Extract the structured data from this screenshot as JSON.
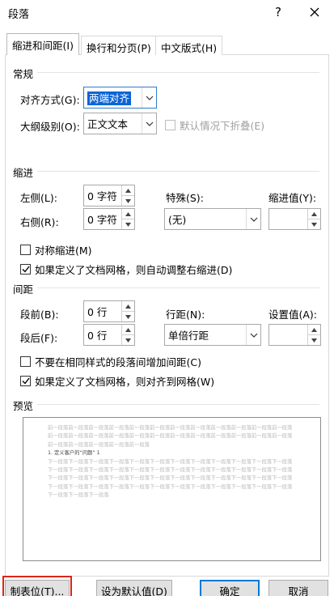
{
  "window": {
    "title": "段落",
    "help": "?",
    "close": "✕"
  },
  "tabs": [
    "缩进和间距(I)",
    "换行和分页(P)",
    "中文版式(H)"
  ],
  "general": {
    "section": "常规",
    "align_label": "对齐方式(G):",
    "align_value": "两端对齐",
    "outline_label": "大纲级别(O):",
    "outline_value": "正文文本",
    "collapse_label": "默认情况下折叠(E)",
    "collapse_checked": false
  },
  "indent": {
    "section": "缩进",
    "left_label": "左侧(L):",
    "left_value": "0 字符",
    "right_label": "右侧(R):",
    "right_value": "0 字符",
    "special_label": "特殊(S):",
    "special_value": "(无)",
    "amount_label": "缩进值(Y):",
    "amount_value": "",
    "mirror_label": "对称缩进(M)",
    "mirror_checked": false,
    "auto_label": "如果定义了文档网格，则自动调整右缩进(D)",
    "auto_checked": true
  },
  "spacing": {
    "section": "间距",
    "before_label": "段前(B):",
    "before_value": "0 行",
    "after_label": "段后(F):",
    "after_value": "0 行",
    "line_label": "行距(N):",
    "line_value": "单倍行距",
    "at_label": "设置值(A):",
    "at_value": "",
    "no_space_label": "不要在相同样式的段落间增加间距(C)",
    "no_space_checked": false,
    "snap_label": "如果定义了文档网格，则对齐到网格(W)",
    "snap_checked": true
  },
  "preview": {
    "section": "预览",
    "prev_lines": [
      "前一段落前一段落前一段落前一段落前一段落前一段落前一段落前一段落前一段落前一段落前一段落前一段落",
      "前一段落前一段落前一段落前一段落前一段落前一段落前一段落前一段落前一段落前一段落前一段落前一段落",
      "前一段落前一段落前一段落前一段落前一段落"
    ],
    "current": "1.  定义客户的“问题”  1",
    "next_lines": [
      "下一段落下一段落下一段落下一段落下一段落下一段落下一段落下一段落下一段落下一段落下一段落下一段落",
      "下一段落下一段落下一段落下一段落下一段落下一段落下一段落下一段落下一段落下一段落下一段落下一段落",
      "下一段落下一段落下一段落下一段落下一段落下一段落下一段落下一段落下一段落下一段落下一段落下一段落",
      "下一段落下一段落下一段落下一段落下一段落下一段落下一段落下一段落下一段落下一段落下一段落下一段落",
      "下一段落下一段落下一段落"
    ]
  },
  "buttons": {
    "tabs": "制表位(T)...",
    "set_default": "设为默认值(D)",
    "ok": "确定",
    "cancel": "取消"
  }
}
